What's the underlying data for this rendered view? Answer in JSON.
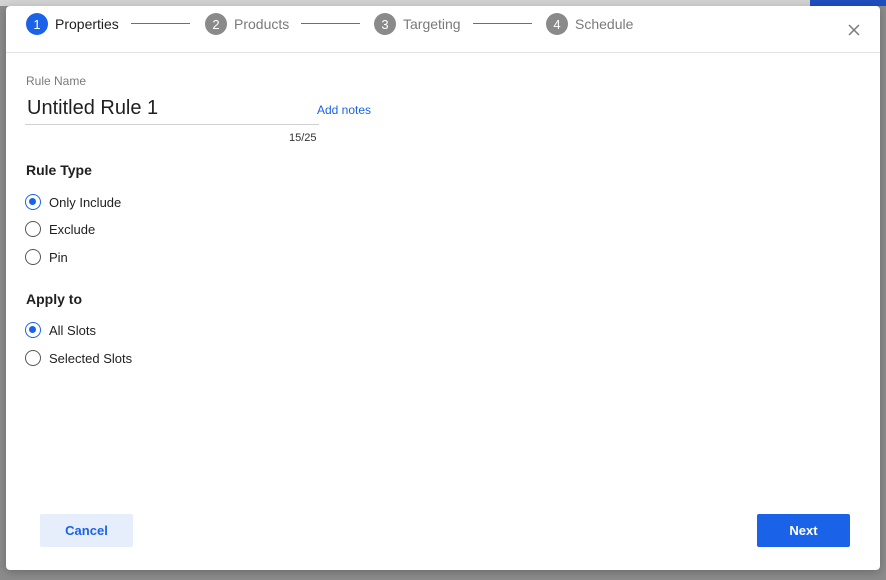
{
  "stepper": {
    "steps": [
      {
        "number": "1",
        "label": "Properties",
        "active": true
      },
      {
        "number": "2",
        "label": "Products",
        "active": false
      },
      {
        "number": "3",
        "label": "Targeting",
        "active": false
      },
      {
        "number": "4",
        "label": "Schedule",
        "active": false
      }
    ],
    "close_icon": "close-icon"
  },
  "rule_name": {
    "label": "Rule Name",
    "value": "Untitled Rule 1",
    "add_notes": "Add notes",
    "char_count": "15/25"
  },
  "rule_type": {
    "title": "Rule Type",
    "options": [
      {
        "label": "Only Include",
        "checked": true
      },
      {
        "label": "Exclude",
        "checked": false
      },
      {
        "label": "Pin",
        "checked": false
      }
    ]
  },
  "apply_to": {
    "title": "Apply to",
    "options": [
      {
        "label": "All Slots",
        "checked": true
      },
      {
        "label": "Selected Slots",
        "checked": false
      }
    ]
  },
  "footer": {
    "cancel_label": "Cancel",
    "next_label": "Next"
  },
  "colors": {
    "accent": "#1a63e8",
    "inactive_step": "#8a8a8a",
    "cancel_bg": "#e6eefb"
  }
}
